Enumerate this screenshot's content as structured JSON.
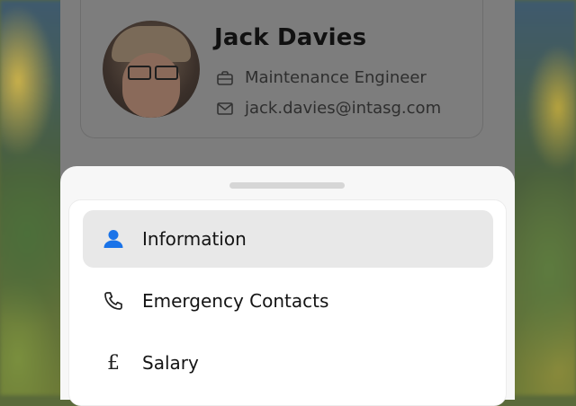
{
  "profile": {
    "name": "Jack Davies",
    "job_title": "Maintenance Engineer",
    "email": "jack.davies@intasg.com",
    "job_icon": "briefcase-icon",
    "email_icon": "mail-icon"
  },
  "menu": {
    "items": [
      {
        "label": "Information",
        "icon": "person-icon",
        "active": true
      },
      {
        "label": "Emergency Contacts",
        "icon": "phone-icon",
        "active": false
      },
      {
        "label": "Salary",
        "icon": "pound-icon",
        "active": false
      }
    ]
  },
  "colors": {
    "accent": "#1a73e8",
    "active_bg": "#e8e8e8",
    "overlay": "#7d7d7d"
  }
}
